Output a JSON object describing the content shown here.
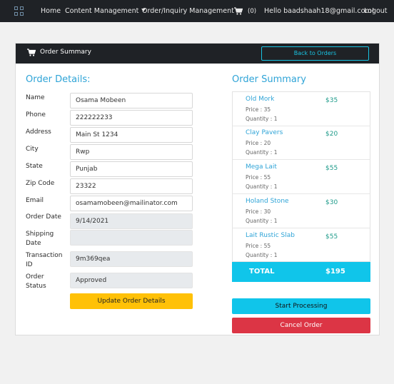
{
  "nav": {
    "home": "Home",
    "content_management": "Content Management",
    "order_inquiry": "Order/Inquiry Management",
    "cart_count": "(0)",
    "greeting": "Hello baadshaah18@gmail.com!",
    "logout": "Logout"
  },
  "card": {
    "title": "Order Summary",
    "back_button": "Back to Orders"
  },
  "order_details": {
    "heading": "Order Details:",
    "fields": [
      {
        "label": "Name",
        "value": "Osama Mobeen"
      },
      {
        "label": "Phone",
        "value": "222222233"
      },
      {
        "label": "Address",
        "value": "Main St 1234"
      },
      {
        "label": "City",
        "value": "Rwp"
      },
      {
        "label": "State",
        "value": "Punjab"
      },
      {
        "label": "Zip Code",
        "value": "23322"
      },
      {
        "label": "Email",
        "value": "osamamobeen@mailinator.com"
      },
      {
        "label": "Order Date",
        "value": "9/14/2021"
      },
      {
        "label": "Shipping Date",
        "value": ""
      },
      {
        "label": "Transaction ID",
        "value": "9m369qea"
      },
      {
        "label": "Order Status",
        "value": "Approved"
      }
    ],
    "update_button": "Update Order Details"
  },
  "order_summary": {
    "heading": "Order Summary",
    "items": [
      {
        "name": "Old Mork",
        "amount": "$35",
        "price": "Price : 35",
        "quantity": "Quantity : 1"
      },
      {
        "name": "Clay Pavers",
        "amount": "$20",
        "price": "Price : 20",
        "quantity": "Quantity : 1"
      },
      {
        "name": "Mega Lait",
        "amount": "$55",
        "price": "Price : 55",
        "quantity": "Quantity : 1"
      },
      {
        "name": "Holand Stone",
        "amount": "$30",
        "price": "Price : 30",
        "quantity": "Quantity : 1"
      },
      {
        "name": "Lait Rustic Slab",
        "amount": "$55",
        "price": "Price : 55",
        "quantity": "Quantity : 1"
      }
    ],
    "total_label": "TOTAL",
    "total_value": "$195",
    "start_button": "Start Processing",
    "cancel_button": "Cancel Order"
  },
  "colors": {
    "navbar": "#1f2226",
    "accent_blue": "#2fa4d7",
    "cyan": "#10c5ea",
    "warning": "#ffc107",
    "danger": "#dc3545",
    "amount_teal": "#1e9b8a"
  },
  "icons": [
    "grid-icon",
    "cart-icon",
    "caret-down-icon"
  ]
}
